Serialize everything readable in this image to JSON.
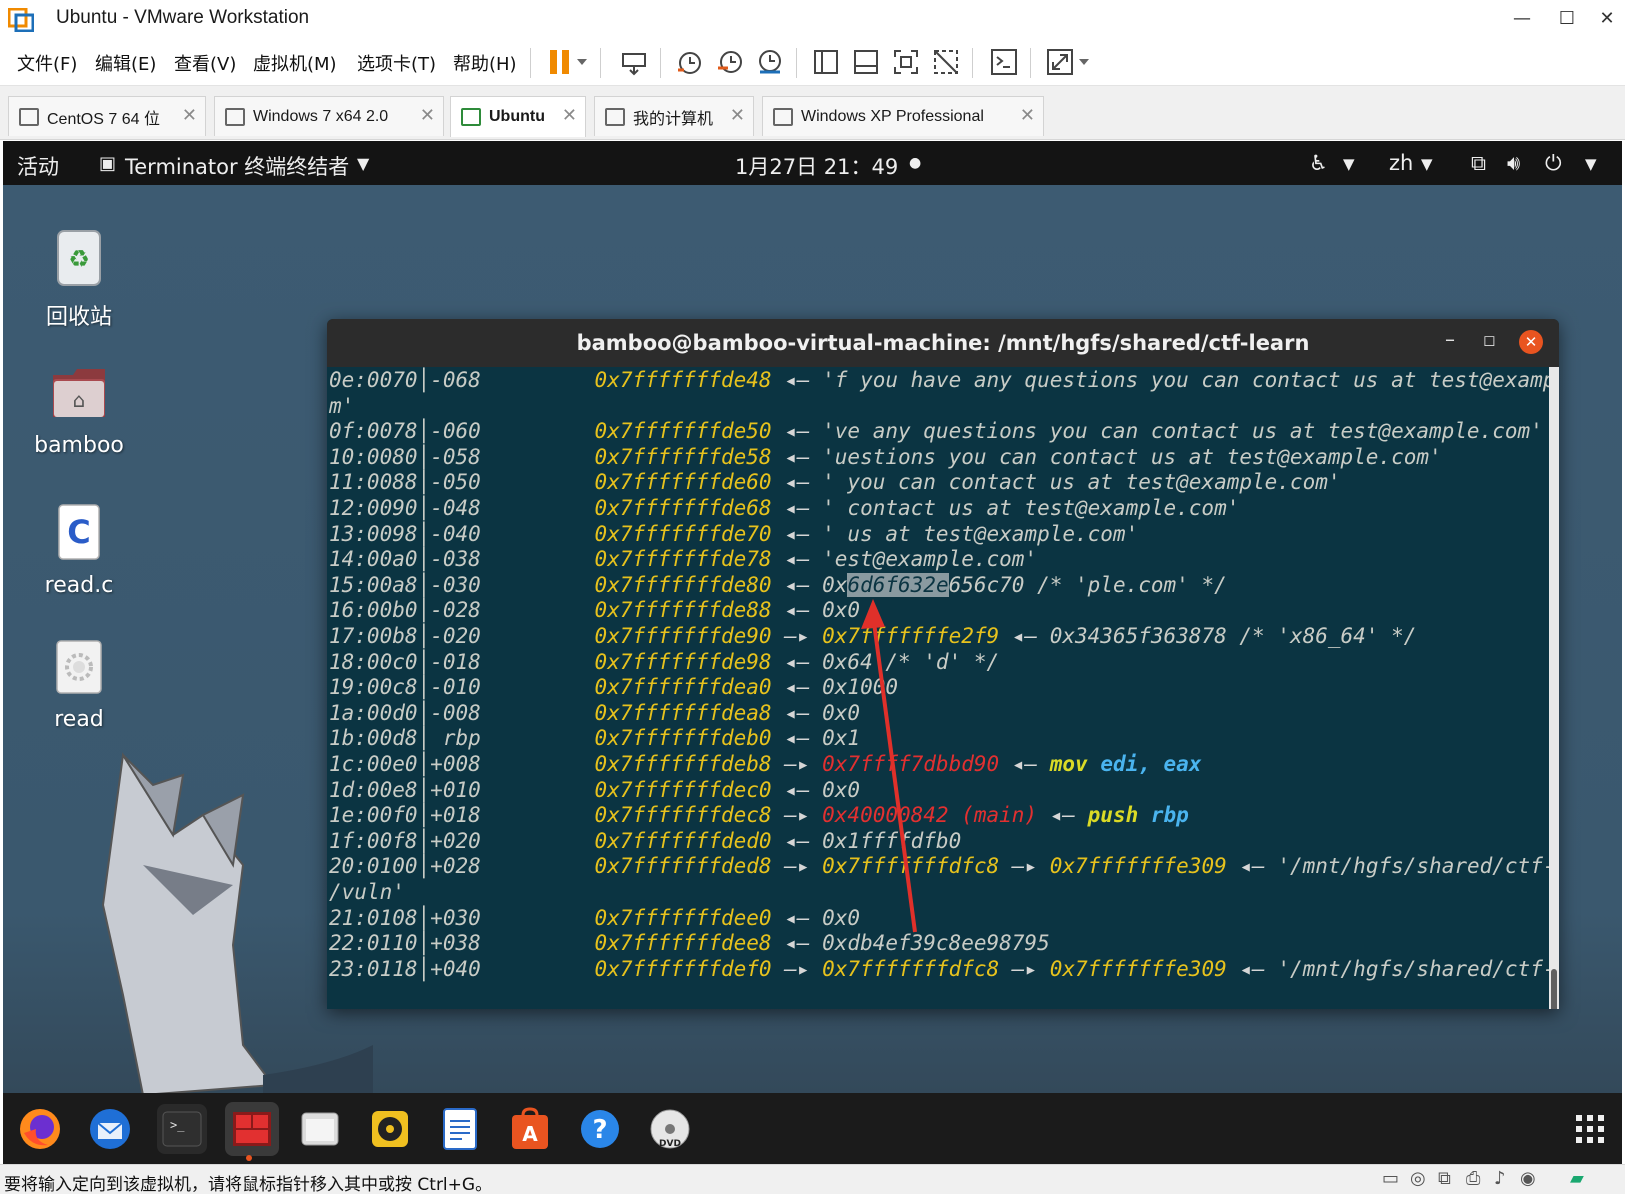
{
  "window": {
    "title": "Ubuntu - VMware Workstation"
  },
  "menu": [
    {
      "label": "文件(F)"
    },
    {
      "label": "编辑(E)"
    },
    {
      "label": "查看(V)"
    },
    {
      "label": "虚拟机(M)"
    },
    {
      "label": "选项卡(T)"
    },
    {
      "label": "帮助(H)"
    }
  ],
  "tabs": [
    {
      "label": "CentOS 7 64 位",
      "active": false
    },
    {
      "label": "Windows 7 x64 2.0",
      "active": false
    },
    {
      "label": "Ubuntu",
      "active": true
    },
    {
      "label": "我的计算机",
      "active": false
    },
    {
      "label": "Windows XP Professional",
      "active": false
    }
  ],
  "gnome": {
    "activities": "活动",
    "app_menu": "Terminator 终端终结者",
    "clock": "1月27日  21：49",
    "lang": "zh"
  },
  "desktop_icons": [
    {
      "label": "回收站"
    },
    {
      "label": "bamboo"
    },
    {
      "label": "read.c"
    },
    {
      "label": "read"
    }
  ],
  "terminal": {
    "title": "bamboo@bamboo-virtual-machine: /mnt/hgfs/shared/ctf-learn",
    "lines": [
      {
        "off": "0e:0070",
        "rel": "-068",
        "addr": "0x7fffffffde48",
        "arrow": "◂—",
        "rest": "'f you have any questions you can contact us at test@example.co"
      },
      {
        "wrap": "m'"
      },
      {
        "off": "0f:0078",
        "rel": "-060",
        "addr": "0x7fffffffde50",
        "arrow": "◂—",
        "rest": "'ve any questions you can contact us at test@example.com'"
      },
      {
        "off": "10:0080",
        "rel": "-058",
        "addr": "0x7fffffffde58",
        "arrow": "◂—",
        "rest": "'uestions you can contact us at test@example.com'"
      },
      {
        "off": "11:0088",
        "rel": "-050",
        "addr": "0x7fffffffde60",
        "arrow": "◂—",
        "rest": "' you can contact us at test@example.com'"
      },
      {
        "off": "12:0090",
        "rel": "-048",
        "addr": "0x7fffffffde68",
        "arrow": "◂—",
        "rest": "' contact us at test@example.com'"
      },
      {
        "off": "13:0098",
        "rel": "-040",
        "addr": "0x7fffffffde70",
        "arrow": "◂—",
        "rest": "' us at test@example.com'"
      },
      {
        "off": "14:00a0",
        "rel": "-038",
        "addr": "0x7fffffffde78",
        "arrow": "◂—",
        "rest": "'est@example.com'"
      },
      {
        "off": "15:00a8",
        "rel": "-030",
        "addr": "0x7fffffffde80",
        "arrow": "◂—",
        "val_pre": "0x",
        "val_sel": "6d6f632e",
        "val_post": "656c70",
        "rest": " /* 'ple.com' */"
      },
      {
        "off": "16:00b0",
        "rel": "-028",
        "addr": "0x7fffffffde88",
        "arrow": "◂—",
        "rest": "0x0"
      },
      {
        "off": "17:00b8",
        "rel": "-020",
        "addr": "0x7fffffffde90",
        "arrow": "—▸",
        "addr2": "0x7fffffffe2f9",
        "arrow2": "◂—",
        "rest": "0x34365f363878 /* 'x86_64' */"
      },
      {
        "off": "18:00c0",
        "rel": "-018",
        "addr": "0x7fffffffde98",
        "arrow": "◂—",
        "rest": "0x64 /* 'd' */"
      },
      {
        "off": "19:00c8",
        "rel": "-010",
        "addr": "0x7fffffffdea0",
        "arrow": "◂—",
        "rest": "0x1000"
      },
      {
        "off": "1a:00d0",
        "rel": "-008",
        "addr": "0x7fffffffdea8",
        "arrow": "◂—",
        "rest": "0x0"
      },
      {
        "off": "1b:00d8",
        "rel": " rbp",
        "addr": "0x7fffffffdeb0",
        "arrow": "◂—",
        "rest": "0x1"
      },
      {
        "off": "1c:00e0",
        "rel": "+008",
        "addr": "0x7fffffffdeb8",
        "arrow": "—▸",
        "red": "0x7ffff7dbbd90",
        "arrow2": "◂—",
        "ins": "mov",
        "reg": "edi, eax"
      },
      {
        "off": "1d:00e8",
        "rel": "+010",
        "addr": "0x7fffffffdec0",
        "arrow": "◂—",
        "rest": "0x0"
      },
      {
        "off": "1e:00f0",
        "rel": "+018",
        "addr": "0x7fffffffdec8",
        "arrow": "—▸",
        "red": "0x40000842 (main)",
        "arrow2": "◂—",
        "ins": "push",
        "reg": "rbp"
      },
      {
        "off": "1f:00f8",
        "rel": "+020",
        "addr": "0x7fffffffded0",
        "arrow": "◂—",
        "rest": "0x1ffffdfb0"
      },
      {
        "off": "20:0100",
        "rel": "+028",
        "addr": "0x7fffffffded8",
        "arrow": "—▸",
        "addr2": "0x7fffffffdfc8",
        "arrow2": "—▸",
        "addr3": "0x7fffffffe309",
        "arrow3": "◂—",
        "rest": "'/mnt/hgfs/shared/ctf-learn"
      },
      {
        "wrap": "/vuln'"
      },
      {
        "off": "21:0108",
        "rel": "+030",
        "addr": "0x7fffffffdee0",
        "arrow": "◂—",
        "rest": "0x0"
      },
      {
        "off": "22:0110",
        "rel": "+038",
        "addr": "0x7fffffffdee8",
        "arrow": "◂—",
        "rest": "0xdb4ef39c8ee98795"
      },
      {
        "off": "23:0118",
        "rel": "+040",
        "addr": "0x7fffffffdef0",
        "arrow": "—▸",
        "addr2": "0x7fffffffdfc8",
        "arrow2": "—▸",
        "addr3": "0x7fffffffe309",
        "arrow3": "◂—",
        "rest": "'/mnt/hgfs/shared/ctf-learn"
      }
    ]
  },
  "dock_items": [
    {
      "icon": "firefox-icon"
    },
    {
      "icon": "thunderbird-icon"
    },
    {
      "icon": "terminal-icon"
    },
    {
      "icon": "terminator-icon"
    },
    {
      "icon": "files-icon"
    },
    {
      "icon": "rhythmbox-icon"
    },
    {
      "icon": "writer-icon"
    },
    {
      "icon": "app-store-icon"
    },
    {
      "icon": "help-icon"
    },
    {
      "icon": "dvd-icon"
    }
  ],
  "status": {
    "text": "要将输入定向到该虚拟机，请将鼠标指针移入其中或按 Ctrl+G。"
  },
  "colors": {
    "terminal_bg": "#0b3442",
    "address": "#e7c21d",
    "pointer_red": "#e23030",
    "register_blue": "#4ab4ef",
    "instruction_yellow": "#dada26",
    "annotation_arrow": "#e0302a"
  }
}
